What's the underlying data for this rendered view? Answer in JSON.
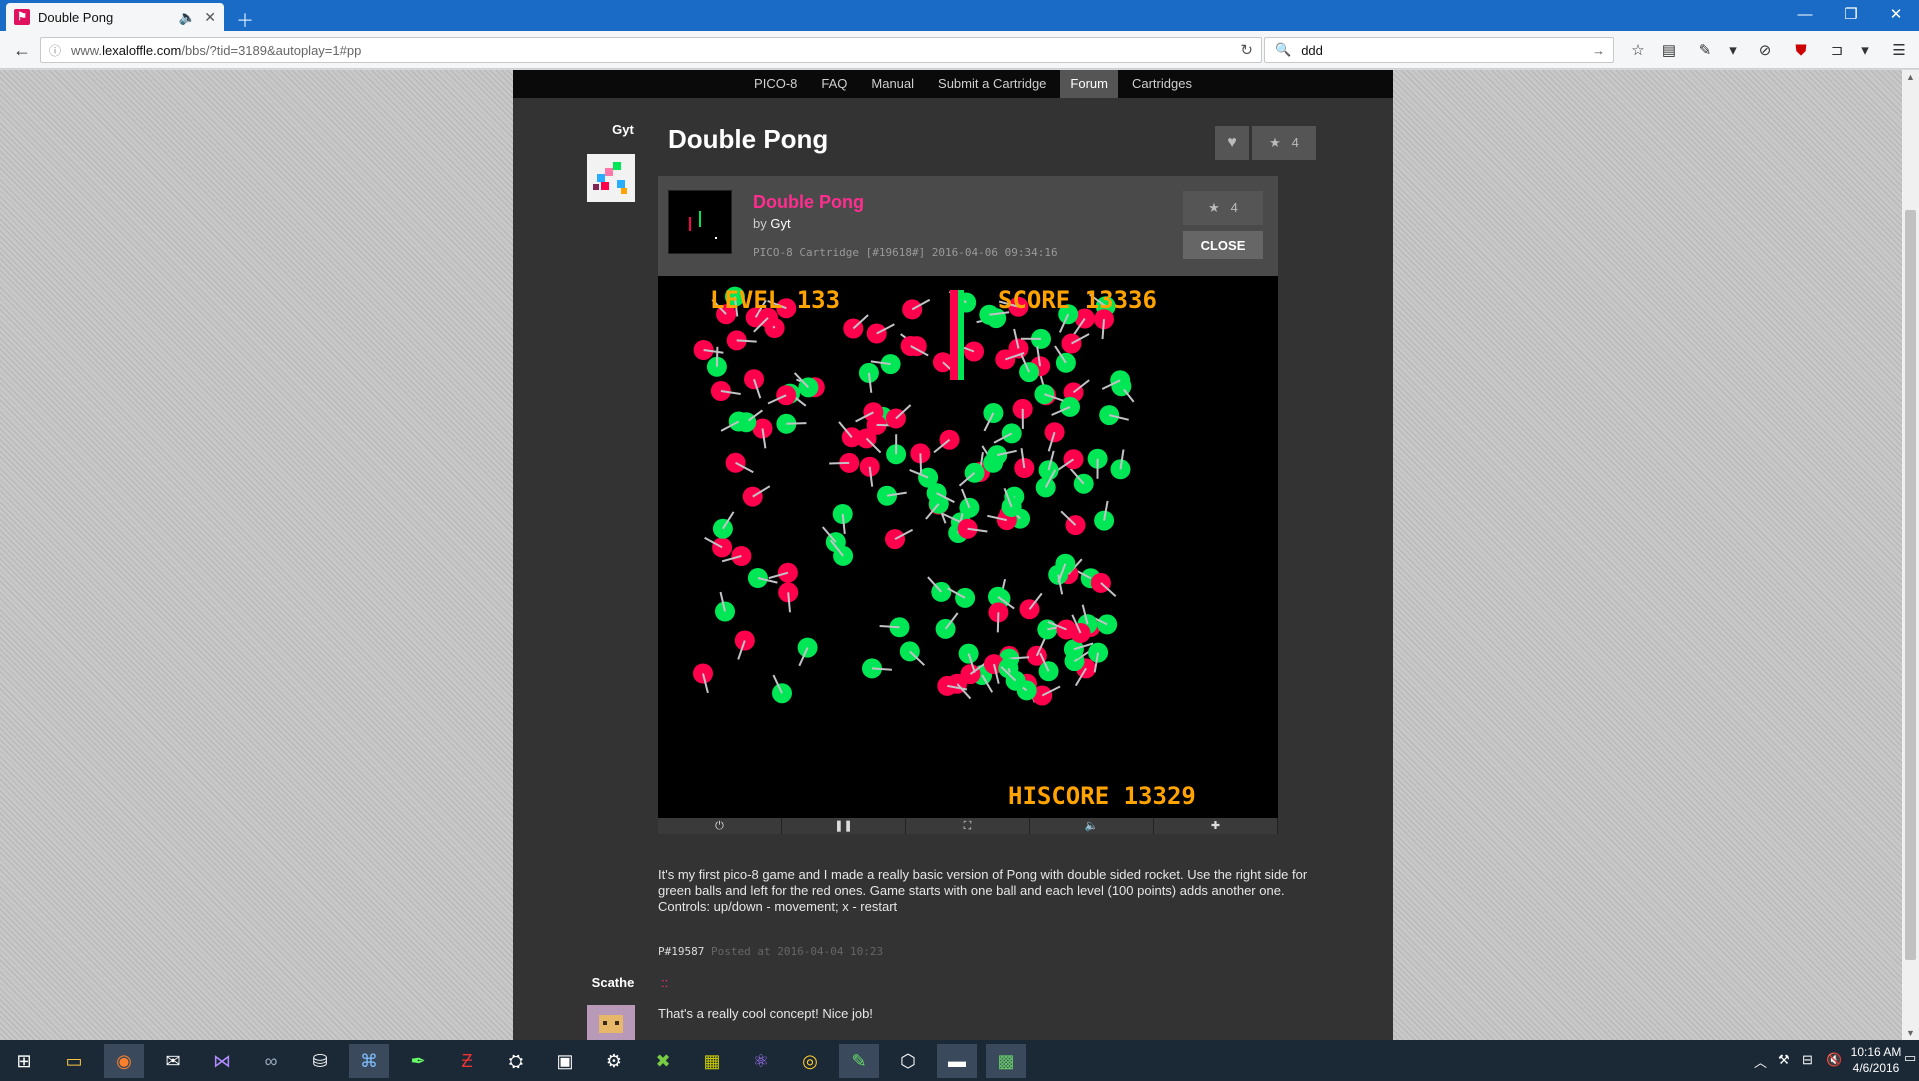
{
  "browser": {
    "tab_title": "Double Pong",
    "url_prefix": "www.",
    "url_domain": "lexaloffle.com",
    "url_rest": "/bbs/?tid=3189&autoplay=1#pp",
    "search_value": "ddd"
  },
  "site_nav": [
    "PICO-8",
    "FAQ",
    "Manual",
    "Submit a Cartridge",
    "Forum",
    "Cartridges"
  ],
  "post": {
    "author": "Gyt",
    "title": "Double Pong",
    "star_count": "4",
    "cartridge": {
      "title": "Double Pong",
      "by_label": "by",
      "author": "Gyt",
      "meta": "PICO-8 Cartridge [#19618#] 2016-04-06 09:34:16",
      "star_count": "4",
      "close_label": "CLOSE"
    },
    "game": {
      "level_text": "LEVEL 133",
      "score_text": "SCORE 13336",
      "hiscore_text": "HISCORE 13329"
    },
    "body_lines": [
      "It's my first pico-8 game and I made a really basic version of Pong with double sided rocket. Use the right side for green balls and left for the red ones. Game starts with one ball and each level (100 points) adds another one.",
      "Controls: up/down - movement; x - restart"
    ],
    "post_id": "P#19587",
    "posted_at": "Posted at 2016-04-04 10:23"
  },
  "comment": {
    "author": "Scathe",
    "marker": "::",
    "text": "That's a really cool concept! Nice job!"
  },
  "taskbar": {
    "time": "10:16 AM",
    "date": "4/6/2016"
  },
  "colors": {
    "accent_pink": "#ff2d8f",
    "ball_green": "#00e756",
    "ball_red": "#ff004d",
    "hud_orange": "#ffa300"
  }
}
